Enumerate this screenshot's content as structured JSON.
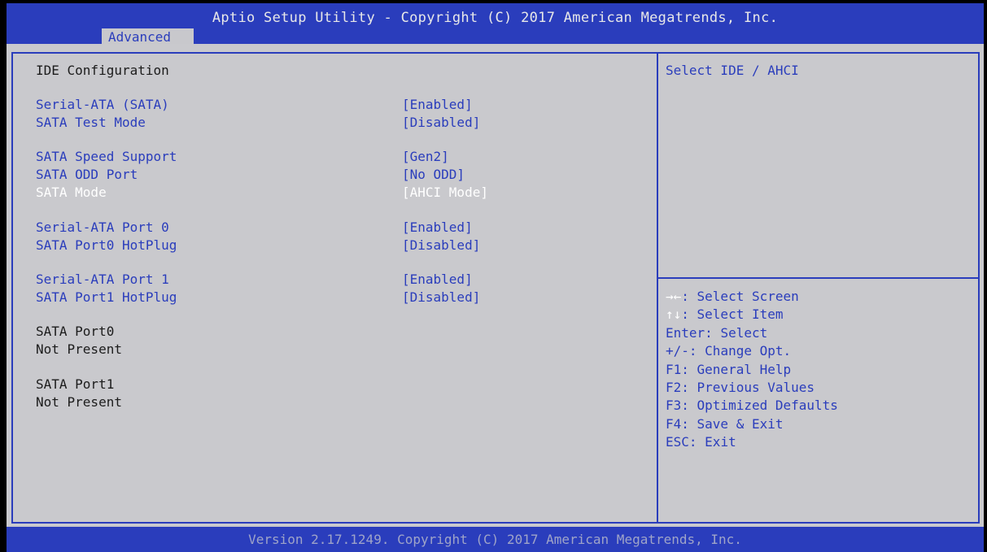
{
  "header": {
    "title": "Aptio Setup Utility - Copyright (C) 2017 American Megatrends, Inc.",
    "tab": "Advanced"
  },
  "section": {
    "heading": "IDE Configuration"
  },
  "settings": [
    {
      "label": "Serial-ATA (SATA)",
      "value": "[Enabled]"
    },
    {
      "label": "SATA Test Mode",
      "value": "[Disabled]"
    },
    {
      "label": "SATA Speed Support",
      "value": "[Gen2]"
    },
    {
      "label": "SATA ODD Port",
      "value": "[No ODD]"
    },
    {
      "label": "SATA Mode",
      "value": "[AHCI Mode]",
      "selected": true
    },
    {
      "label": "Serial-ATA Port 0",
      "value": "[Enabled]"
    },
    {
      "label": "SATA Port0 HotPlug",
      "value": "[Disabled]"
    },
    {
      "label": "Serial-ATA Port 1",
      "value": "[Enabled]"
    },
    {
      "label": "SATA Port1 HotPlug",
      "value": "[Disabled]"
    }
  ],
  "status": [
    {
      "label": "SATA Port0",
      "value": "Not Present"
    },
    {
      "label": "SATA Port1",
      "value": "Not Present"
    }
  ],
  "help": {
    "description": "Select IDE / AHCI",
    "keys": [
      {
        "key": "→←",
        "text": ": Select Screen"
      },
      {
        "key": "↑↓",
        "text": ": Select Item"
      },
      {
        "key": "Enter",
        "text": ": Select"
      },
      {
        "key": "+/-",
        "text": ": Change Opt."
      },
      {
        "key": "F1",
        "text": ": General Help"
      },
      {
        "key": "F2",
        "text": ": Previous Values"
      },
      {
        "key": "F3",
        "text": ": Optimized Defaults"
      },
      {
        "key": "F4",
        "text": ": Save & Exit"
      },
      {
        "key": "ESC",
        "text": ": Exit"
      }
    ]
  },
  "footer": {
    "version": "Version 2.17.1249. Copyright (C) 2017 American Megatrends, Inc."
  },
  "colors": {
    "accent_blue": "#2a3dbc",
    "panel_gray": "#c9c9cd",
    "selected_text": "#ffffff"
  }
}
